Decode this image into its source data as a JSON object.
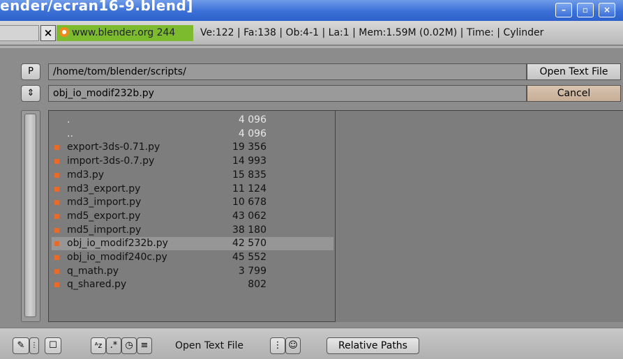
{
  "window": {
    "title": "ender/ecran16-9.blend]",
    "controls": [
      "–",
      "▫",
      "×"
    ]
  },
  "infobar": {
    "close_label": "×",
    "site": "www.blender.org 244",
    "stats": "Ve:122 | Fa:138 | Ob:4-1 | La:1  | Mem:1.59M (0.02M)  | Time: | Cylinder"
  },
  "path_row": {
    "parent_button": "P",
    "directory": "/home/tom/blender/scripts/",
    "action_button": "Open Text File"
  },
  "file_row": {
    "sort_button": "⇕",
    "filename": "obj_io_modif232b.py",
    "cancel_button": "Cancel"
  },
  "files": [
    {
      "name": ".",
      "size": "4 096",
      "type": "dir"
    },
    {
      "name": "..",
      "size": "4 096",
      "type": "dir"
    },
    {
      "name": "export-3ds-0.71.py",
      "size": "19 356",
      "type": "file"
    },
    {
      "name": "import-3ds-0.7.py",
      "size": "14 993",
      "type": "file"
    },
    {
      "name": "md3.py",
      "size": "15 835",
      "type": "file"
    },
    {
      "name": "md3_export.py",
      "size": "11 124",
      "type": "file"
    },
    {
      "name": "md3_import.py",
      "size": "10 678",
      "type": "file"
    },
    {
      "name": "md5_export.py",
      "size": "43 062",
      "type": "file"
    },
    {
      "name": "md5_import.py",
      "size": "38 180",
      "type": "file"
    },
    {
      "name": "obj_io_modif232b.py",
      "size": "42 570",
      "type": "file",
      "selected": true
    },
    {
      "name": "obj_io_modif240c.py",
      "size": "45 552",
      "type": "file"
    },
    {
      "name": "q_math.py",
      "size": "3 799",
      "type": "file"
    },
    {
      "name": "q_shared.py",
      "size": "802",
      "type": "file"
    }
  ],
  "bottombar": {
    "editor_type_icon": "✎",
    "fullscreen_icon": "☐",
    "sort_alpha_icon": "ᴬz",
    "sort_ext_icon": ".*",
    "sort_time_icon": "◷",
    "sort_size_icon": "≡",
    "label": "Open Text File",
    "show_details_icon": "⋮",
    "hide_dot_icon": "☺",
    "relative_paths": "Relative Paths"
  },
  "colors": {
    "file_marker": "#e86b2a",
    "site_badge": "#7cbb2e",
    "titlebar": "#3a6fd6"
  }
}
